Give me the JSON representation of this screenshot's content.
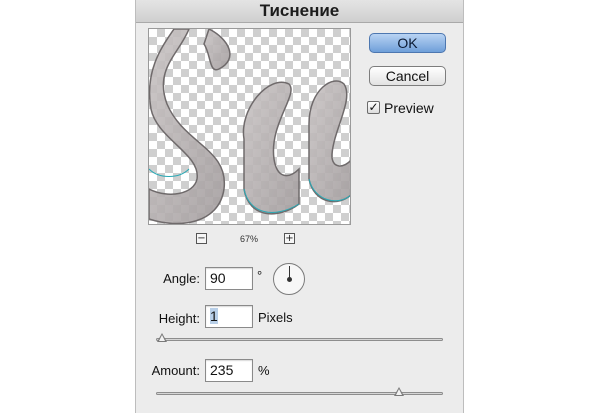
{
  "dialog": {
    "title": "Тиснение",
    "ok_label": "OK",
    "cancel_label": "Cancel",
    "preview_label": "Preview",
    "preview_checked": true,
    "check_glyph": "✓"
  },
  "zoom": {
    "minus_glyph": "−",
    "plus_glyph": "+",
    "level": "67%"
  },
  "angle": {
    "label": "Angle:",
    "value": "90",
    "unit": "°"
  },
  "height": {
    "label": "Height:",
    "value": "1",
    "unit": "Pixels",
    "slider_fraction": 0.0
  },
  "amount": {
    "label": "Amount:",
    "value": "235",
    "unit": "%",
    "slider_fraction": 0.86
  },
  "colors": {
    "dialog_bg": "#ececec",
    "ok_button": "#7ba7df",
    "selection": "#b8cfe8"
  }
}
